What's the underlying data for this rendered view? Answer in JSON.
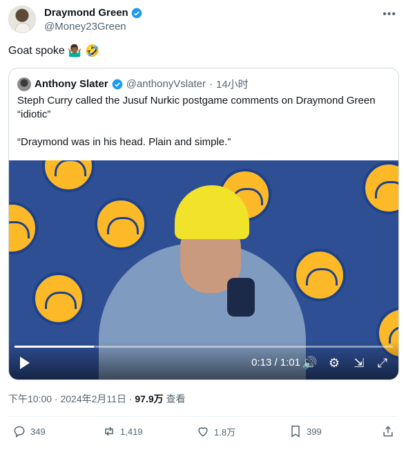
{
  "author": {
    "name": "Draymond Green",
    "handle": "@Money23Green"
  },
  "tweet": {
    "text": "Goat spoke",
    "emojis": [
      "🤷🏾‍♂️",
      "🤣"
    ]
  },
  "quote": {
    "name": "Anthony Slater",
    "handle": "@anthonyVslater",
    "dot": "·",
    "time": "14小时",
    "paragraphs": [
      "Steph Curry called the Jusuf Nurkic postgame comments on Draymond Green “idiotic”",
      "“Draymond was in his head. Plain and simple.”"
    ],
    "video": {
      "time": "0:13 / 1:01",
      "progress": 0.21
    }
  },
  "meta": {
    "timestamp": "下午10:00 · 2024年2月11日 · ",
    "views": "97.9万",
    "views_label": " 查看"
  },
  "actions": {
    "replies": "349",
    "reposts": "1,419",
    "likes": "1.8万",
    "bookmarks": "399"
  },
  "colors": {
    "verified": "#1d9bf0",
    "secondary_text": "#536471",
    "video_backdrop": "#2f4f94"
  }
}
